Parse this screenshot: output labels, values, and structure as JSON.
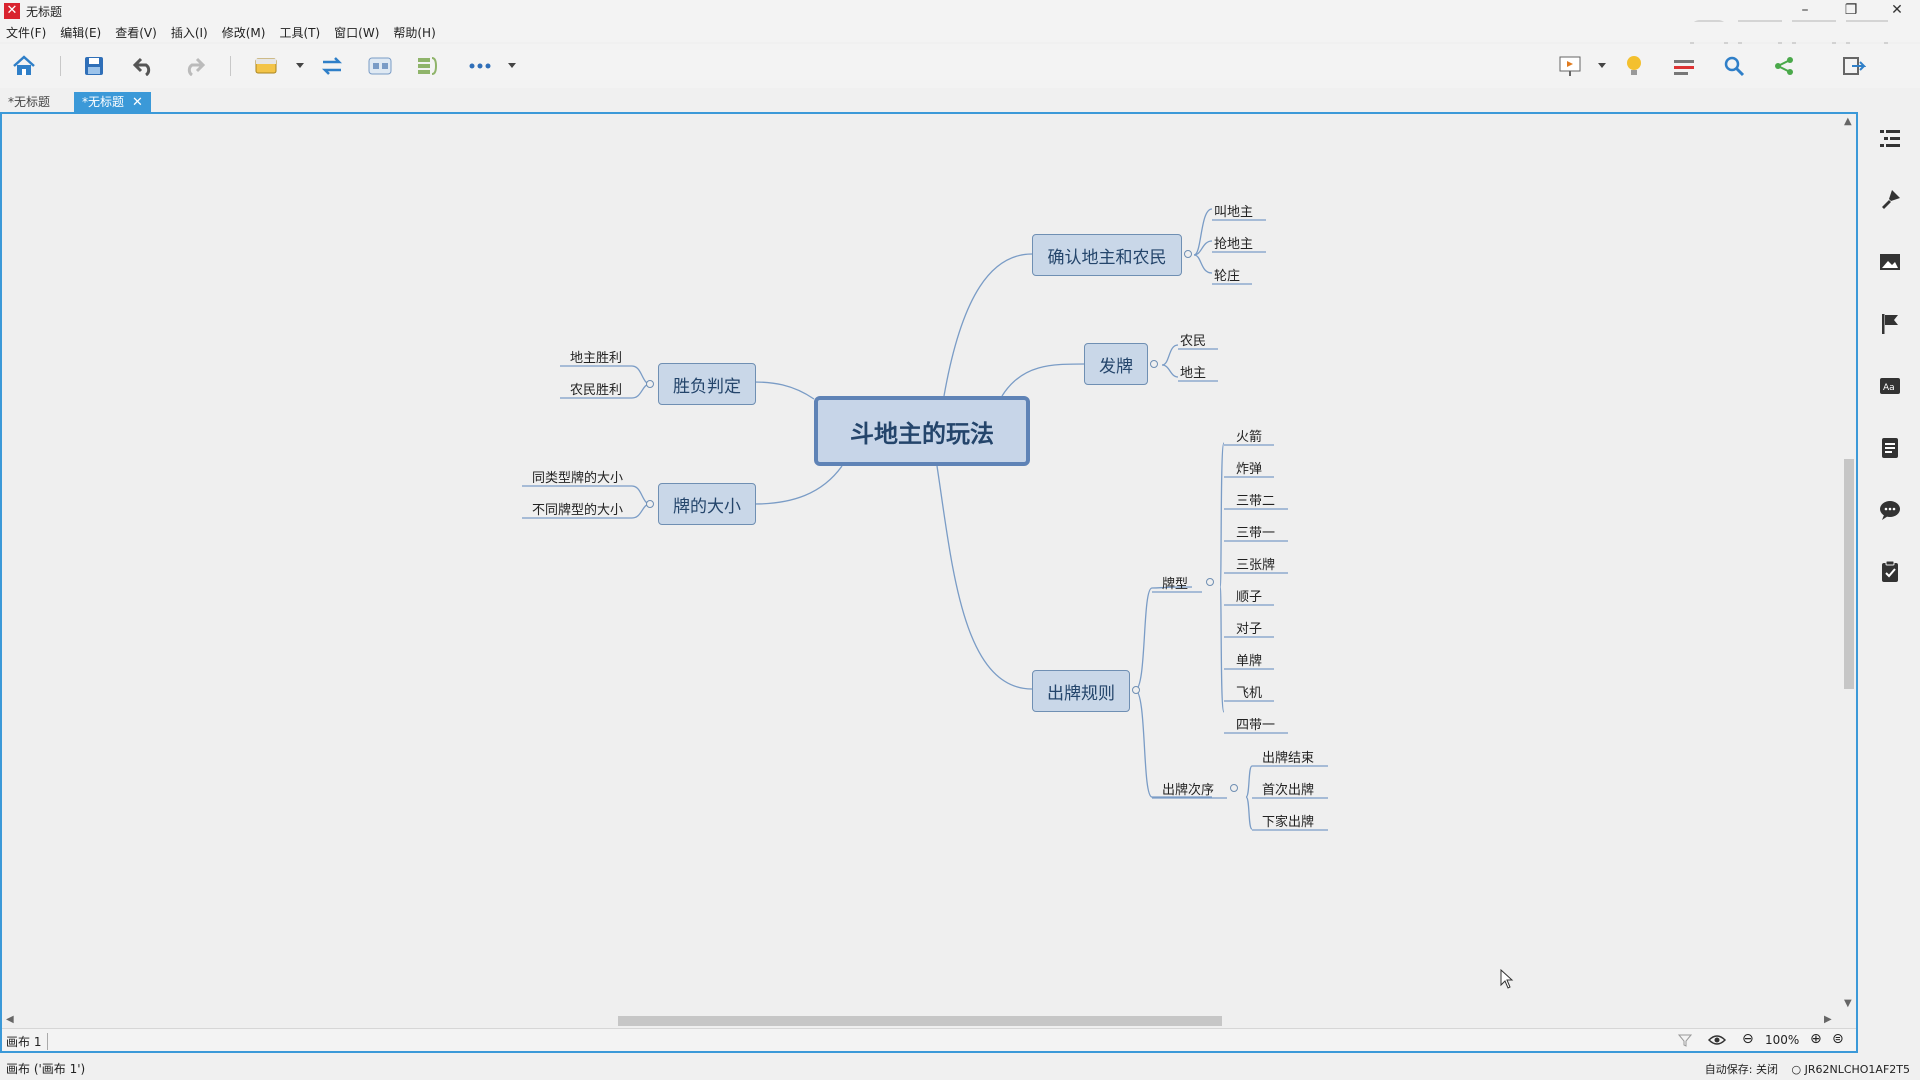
{
  "window": {
    "title": "无标题"
  },
  "menu": [
    "文件(F)",
    "编辑(E)",
    "查看(V)",
    "插入(I)",
    "修改(M)",
    "工具(T)",
    "窗口(W)",
    "帮助(H)"
  ],
  "tabs": [
    {
      "label": "*无标题",
      "active": false
    },
    {
      "label": "*无标题",
      "active": true
    }
  ],
  "mindmap": {
    "central": "斗地主的玩法",
    "topics": {
      "landlord": {
        "label": "确认地主和农民",
        "children": [
          "叫地主",
          "抢地主",
          "轮庄"
        ]
      },
      "deal": {
        "label": "发牌",
        "children": [
          "农民",
          "地主"
        ]
      },
      "rules": {
        "label": "出牌规则",
        "sub": {
          "types": {
            "label": "牌型",
            "children": [
              "火箭",
              "炸弹",
              "三带二",
              "三带一",
              "三张牌",
              "顺子",
              "对子",
              "单牌",
              "飞机",
              "四带一"
            ]
          },
          "order": {
            "label": "出牌次序",
            "children": [
              "出牌结束",
              "首次出牌",
              "下家出牌"
            ]
          }
        }
      },
      "win": {
        "label": "胜负判定",
        "children": [
          "地主胜利",
          "农民胜利"
        ]
      },
      "size": {
        "label": "牌的大小",
        "children": [
          "同类型牌的大小",
          "不同牌型的大小"
        ]
      }
    }
  },
  "sheet": {
    "tab": "画布 1",
    "zoom": "100%"
  },
  "status": {
    "left": "画布 ('画布 1')",
    "autosave": "自动保存: 关闭",
    "user": "JR62NLCHO1AF2T5"
  },
  "colors": {
    "accent": "#3b99d8",
    "node_fill": "#c9d7e8",
    "node_border": "#6f8fb3",
    "line": "#7a9cc6"
  }
}
